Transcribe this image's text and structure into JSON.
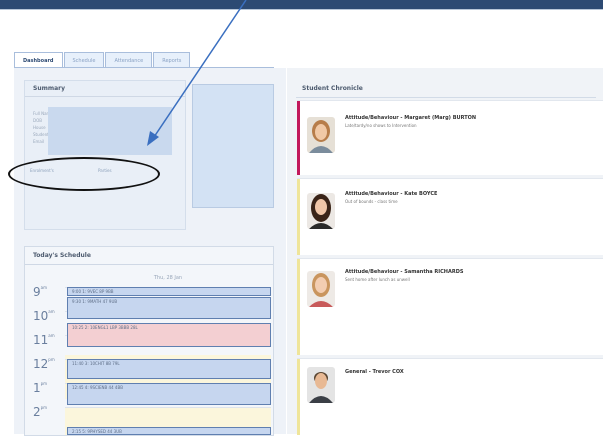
{
  "tabs": [
    "Dashboard",
    "Schedule",
    "Attendance",
    "Reports"
  ],
  "summary": {
    "title": "Summary",
    "fields": [
      "Full Name",
      "DOB",
      "House",
      "Student ID",
      "Email"
    ],
    "enrolment_link": "Enrolment's",
    "parties_link": "Parties"
  },
  "schedule": {
    "title": "Today's Schedule",
    "day_label": "Thu, 28 Jan",
    "hours": [
      {
        "label": "9",
        "suffix": "am"
      },
      {
        "label": "10",
        "suffix": "am"
      },
      {
        "label": "11",
        "suffix": "am"
      },
      {
        "label": "12",
        "suffix": "pm"
      },
      {
        "label": "1",
        "suffix": "pm"
      },
      {
        "label": "2",
        "suffix": "pm"
      }
    ],
    "appointments": [
      {
        "text": "9:00 1: 9VEC 8P 9BB",
        "color": "blue"
      },
      {
        "text": "9:30 1: 9MATH 47 9UB",
        "color": "blue"
      },
      {
        "text": "10:25 2: 10ENGL1 LBP 3BBB 28L",
        "color": "pink"
      },
      {
        "text": "11:40 3: 10CHIT 8B 79L",
        "color": "blue"
      },
      {
        "text": "12:45 4: 9SCIENB 44 4BB",
        "color": "blue"
      },
      {
        "text": "2:15 5: 9PHYSED 44 3UB",
        "color": "blue"
      }
    ]
  },
  "chronicle": {
    "title": "Student Chronicle",
    "entries": [
      {
        "title": "Attitude/Behaviour - Margaret (Marg) BURTON",
        "subtitle": "Late/tardy/no shows to Intervention",
        "accent": "#c2185b"
      },
      {
        "title": "Attitude/Behaviour - Kate BOYCE",
        "subtitle": "Out of bounds - class time",
        "accent": "#efe59a"
      },
      {
        "title": "Attitude/Behaviour - Samantha RICHARDS",
        "subtitle": "Sent home after lunch as unwell",
        "accent": "#efe59a"
      },
      {
        "title": "General - Trevor COX",
        "subtitle": "",
        "accent": "#efe59a"
      }
    ]
  },
  "colors": {
    "header_bar": "#2d4a73",
    "annotation_arrow": "#3a6fc0",
    "appointment_blue": "#c6d6ef",
    "appointment_pink": "#f3cfd2"
  }
}
